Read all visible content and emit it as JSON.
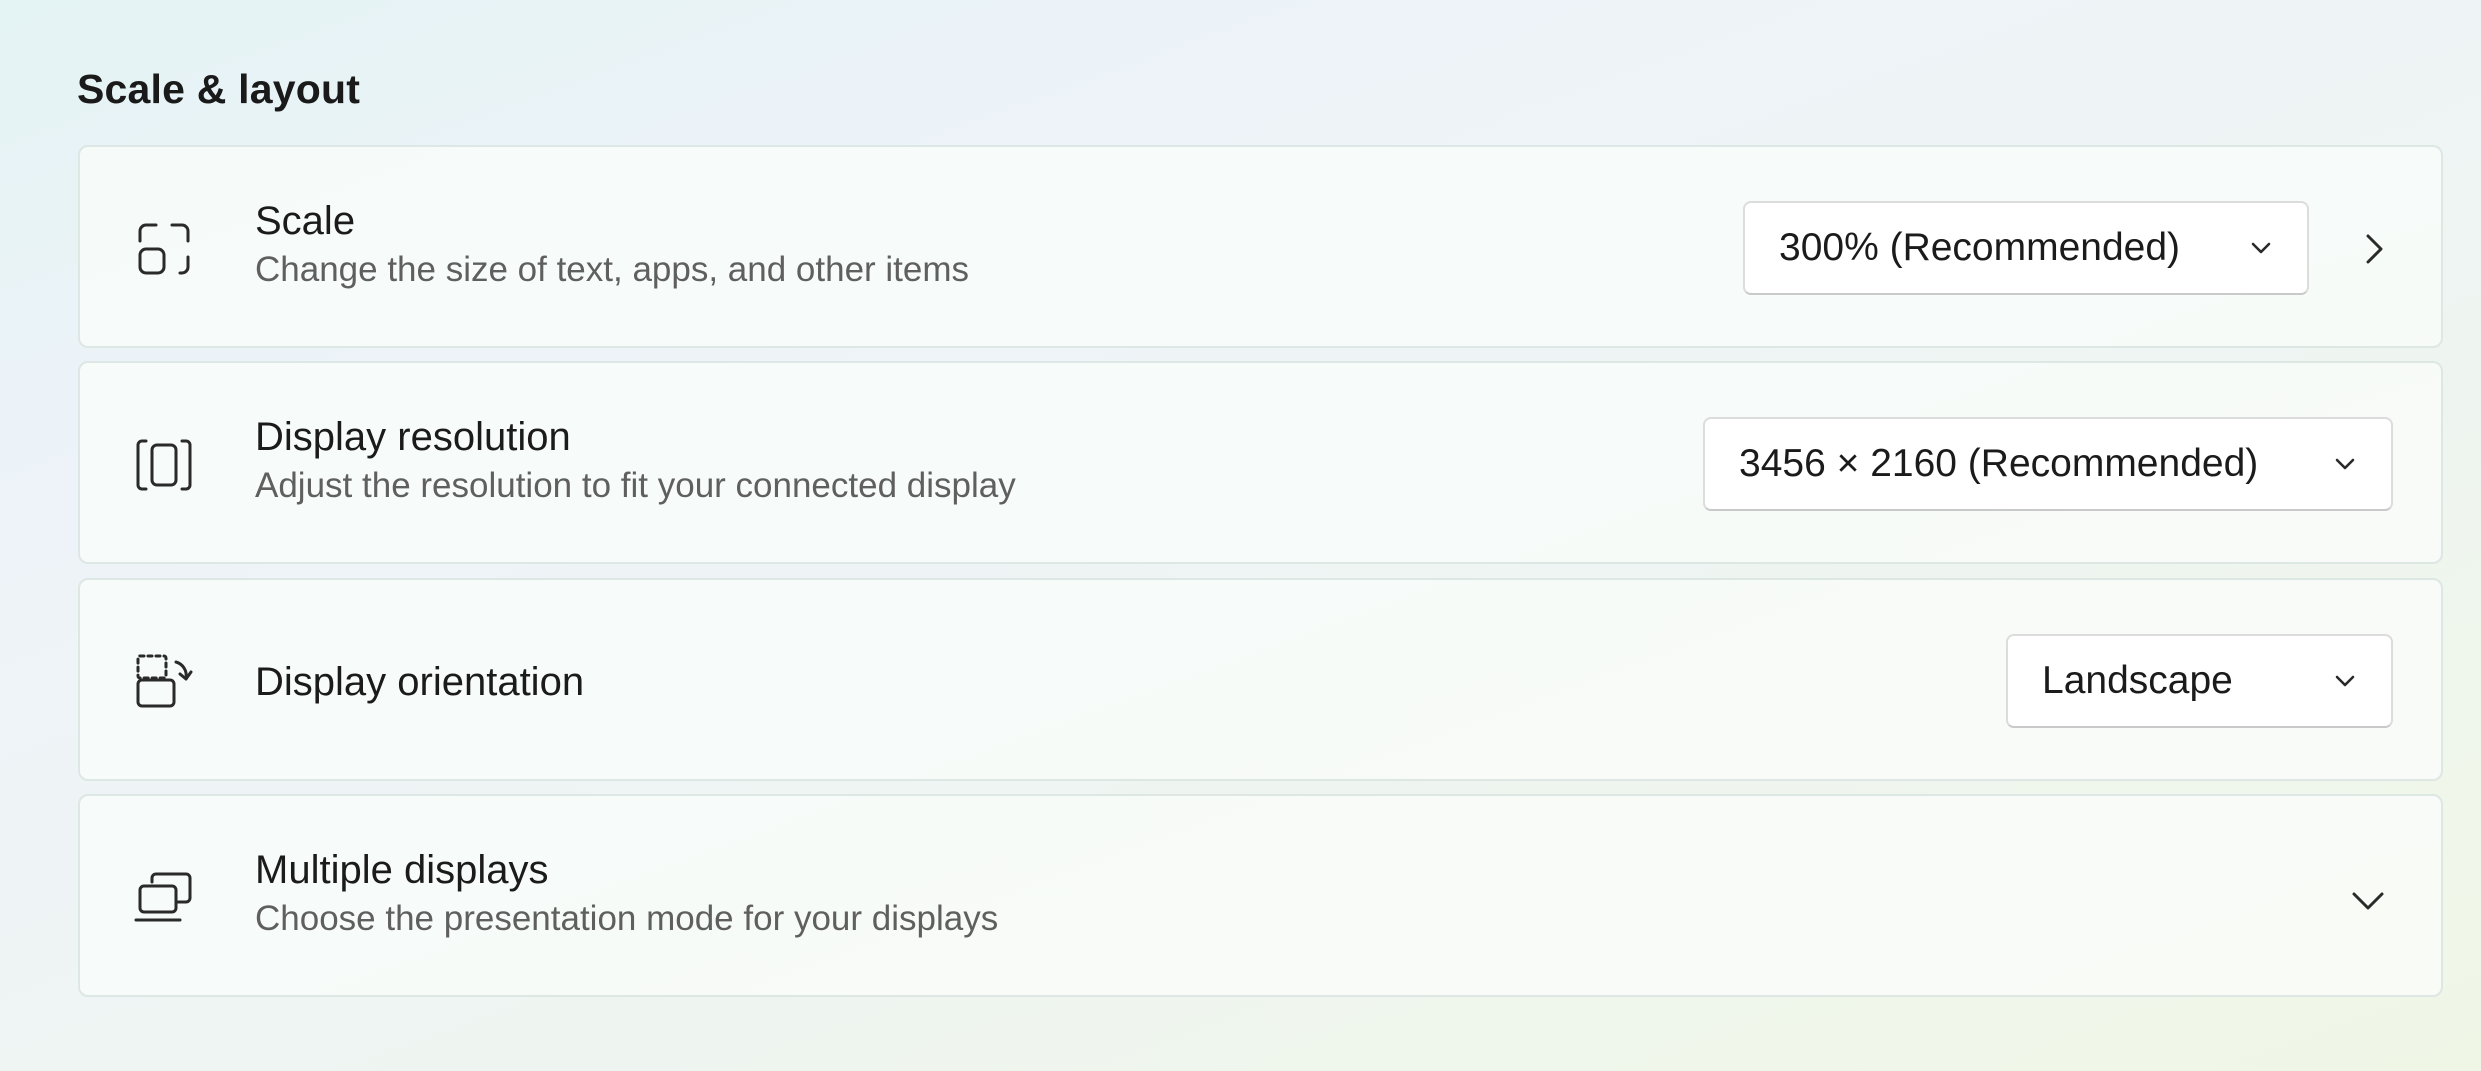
{
  "section": {
    "title": "Scale & layout"
  },
  "rows": [
    {
      "icon": "scale-icon",
      "title": "Scale",
      "description": "Change the size of text, apps, and other items",
      "dropdown_value": "300% (Recommended)",
      "trailing_icon": "chevron-right-icon"
    },
    {
      "icon": "display-resolution-icon",
      "title": "Display resolution",
      "description": "Adjust the resolution to fit your connected display",
      "dropdown_value": "3456 × 2160 (Recommended)"
    },
    {
      "icon": "display-orientation-icon",
      "title": "Display orientation",
      "dropdown_value": "Landscape"
    },
    {
      "icon": "multiple-displays-icon",
      "title": "Multiple displays",
      "description": "Choose the presentation mode for your displays",
      "trailing_icon": "chevron-down-icon"
    }
  ],
  "colors": {
    "text_primary": "#1b1b1b",
    "text_secondary": "#5f5f5f",
    "card_border": "#dde7e3",
    "dropdown_background": "#ffffff"
  }
}
